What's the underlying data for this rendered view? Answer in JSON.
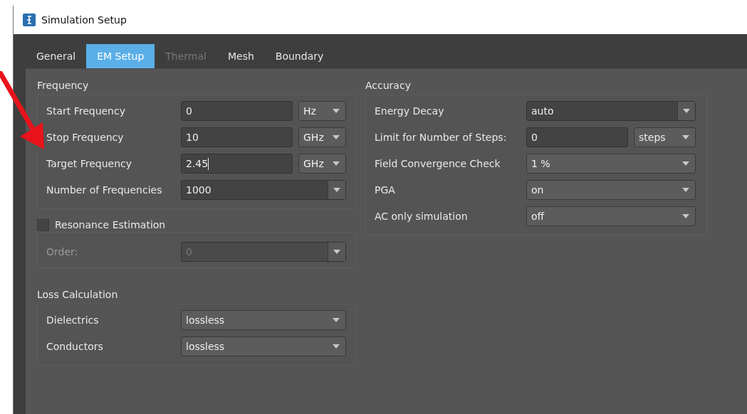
{
  "window": {
    "title": "Simulation Setup"
  },
  "tabs": [
    {
      "label": "General",
      "selected": false,
      "disabled": false
    },
    {
      "label": "EM Setup",
      "selected": true,
      "disabled": false
    },
    {
      "label": "Thermal",
      "selected": false,
      "disabled": true
    },
    {
      "label": "Mesh",
      "selected": false,
      "disabled": false
    },
    {
      "label": "Boundary",
      "selected": false,
      "disabled": false
    }
  ],
  "frequency": {
    "title": "Frequency",
    "rows": [
      {
        "kind": "text_unit",
        "label": "Start Frequency",
        "value": "0",
        "unit": "Hz"
      },
      {
        "kind": "text_unit",
        "label": "Stop Frequency",
        "value": "10",
        "unit": "GHz"
      },
      {
        "kind": "text_unit",
        "label": "Target Frequency",
        "value": "2.45",
        "unit": "GHz",
        "focused": true
      },
      {
        "kind": "editable_combo",
        "label": "Number of Frequencies",
        "value": "1000"
      }
    ]
  },
  "resonance": {
    "label": "Resonance Estimation",
    "checked": false,
    "rows": [
      {
        "kind": "editable_combo",
        "label": "Order:",
        "value": "0",
        "disabled": true
      }
    ]
  },
  "loss": {
    "title": "Loss Calculation",
    "rows": [
      {
        "kind": "combo",
        "label": "Dielectrics",
        "value": "lossless"
      },
      {
        "kind": "combo",
        "label": "Conductors",
        "value": "lossless"
      }
    ]
  },
  "accuracy": {
    "title": "Accuracy",
    "rows": [
      {
        "kind": "editable_combo",
        "label": "Energy Decay",
        "value": "auto"
      },
      {
        "kind": "text_unit",
        "label": "Limit for Number of Steps:",
        "value": "0",
        "unit": "steps"
      },
      {
        "kind": "combo",
        "label": "Field Convergence Check",
        "value": "1 %"
      },
      {
        "kind": "combo",
        "label": "PGA",
        "value": "on"
      },
      {
        "kind": "combo",
        "label": "AC only simulation",
        "value": "off"
      }
    ]
  }
}
